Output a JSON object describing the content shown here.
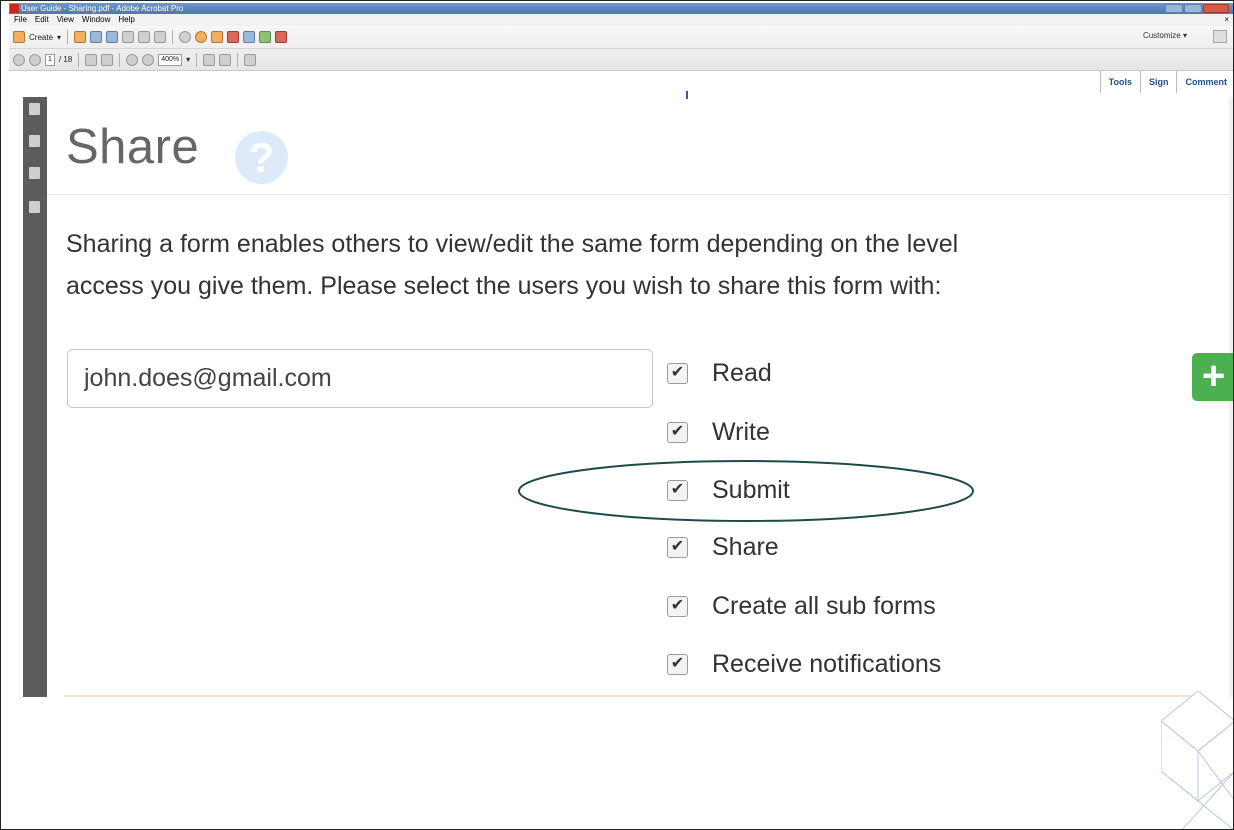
{
  "window": {
    "title": "User Guide - Sharing.pdf - Adobe Acrobat Pro"
  },
  "menu": {
    "items": [
      "File",
      "Edit",
      "View",
      "Window",
      "Help"
    ],
    "close_glyph": "×"
  },
  "toolbar": {
    "create_label": "Create",
    "page_current": "1",
    "page_total": "/ 18",
    "zoom": "400%",
    "customize_label": "Customize",
    "tabs": [
      "Tools",
      "Sign",
      "Comment"
    ]
  },
  "document": {
    "title": "Share",
    "help_glyph": "?",
    "description_line1": "Sharing a form enables others to view/edit the same form depending on the level",
    "description_line2": "access you give them. Please select the users you wish to share this form with:",
    "email_value": "john.does@gmail.com",
    "permissions": [
      {
        "label": "Read",
        "checked": true
      },
      {
        "label": "Write",
        "checked": true
      },
      {
        "label": "Submit",
        "checked": true
      },
      {
        "label": "Share",
        "checked": true
      },
      {
        "label": "Create all sub forms",
        "checked": true
      },
      {
        "label": "Receive notifications",
        "checked": true
      }
    ],
    "check_glyph": "✔",
    "add_glyph": "+"
  },
  "colors": {
    "add_button": "#4caf50",
    "highlight_ellipse": "#1d4a4a",
    "help_icon": "#dcebf7",
    "title_bar": "#4a78b0"
  },
  "icons": {
    "help": "question-circle-icon",
    "add": "plus-icon",
    "check": "checkmark-icon"
  }
}
